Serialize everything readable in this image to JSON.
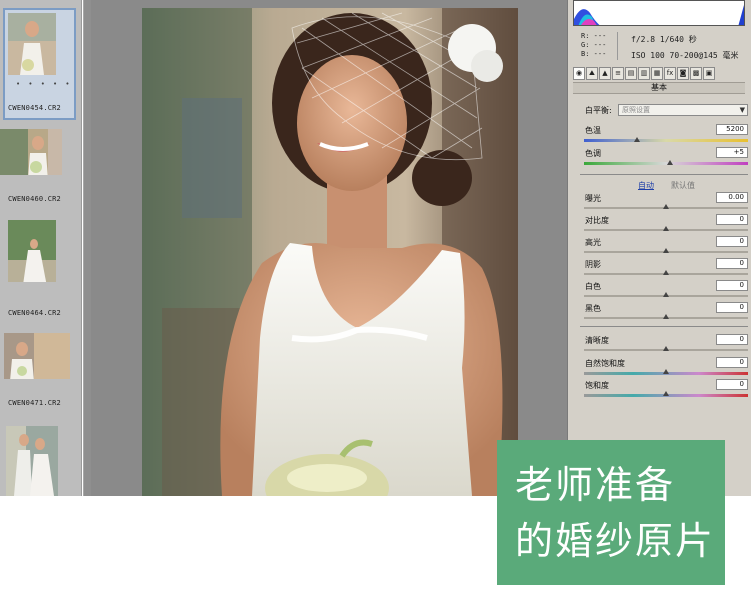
{
  "filmstrip": {
    "items": [
      {
        "label": "CWEN0454.CR2",
        "dots": "• • • • •"
      },
      {
        "label": "CWEN0460.CR2"
      },
      {
        "label": "CWEN0464.CR2"
      },
      {
        "label": "CWEN0471.CR2"
      },
      {
        "label": ""
      }
    ]
  },
  "readout": {
    "rgb": [
      "R:  ---",
      "G:  ---",
      "B:  ---"
    ],
    "line1": "f/2.8  1/640 秒",
    "line2": "ISO 100  70-200@145 毫米"
  },
  "toolbar": {
    "tools": [
      "◉",
      "⛰",
      "▲",
      "≡",
      "▤",
      "▥",
      "▦",
      "fx",
      "◙",
      "▩",
      "▣"
    ]
  },
  "basic": {
    "section_title": "基本",
    "white_balance_label": "白平衡:",
    "white_balance_value": "原照设置",
    "temperature_label": "色温",
    "temperature_value": "5200",
    "tint_label": "色调",
    "tint_value": "+5",
    "auto_link": "自动",
    "default_link": "默认值",
    "sliders": [
      {
        "label": "曝光",
        "value": "0.00"
      },
      {
        "label": "对比度",
        "value": "0"
      },
      {
        "label": "高光",
        "value": "0"
      },
      {
        "label": "阴影",
        "value": "0"
      },
      {
        "label": "白色",
        "value": "0"
      },
      {
        "label": "黑色",
        "value": "0"
      }
    ],
    "presence": [
      {
        "label": "清晰度",
        "value": "0"
      },
      {
        "label": "自然饱和度",
        "value": "0"
      },
      {
        "label": "饱和度",
        "value": "0"
      }
    ]
  },
  "caption": {
    "line1": "老师准备",
    "line2": "的婚纱原片"
  },
  "colors": {
    "caption_bg": "#5aaa7a",
    "panel_bg": "#d4d0c8",
    "link": "#1f3fa8"
  }
}
